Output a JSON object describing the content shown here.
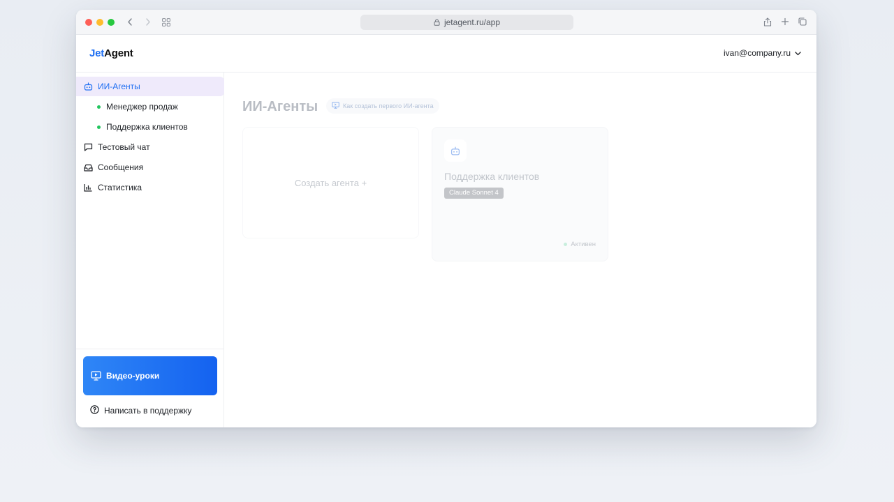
{
  "browser": {
    "url": "jetagent.ru/app"
  },
  "header": {
    "logo_part1": "Jet",
    "logo_part2": "Agent",
    "user_email": "ivan@company.ru"
  },
  "sidebar": {
    "items": [
      {
        "label": "ИИ-Агенты",
        "icon": "robot-icon",
        "active": true
      },
      {
        "label": "Тестовый чат",
        "icon": "chat-icon"
      },
      {
        "label": "Сообщения",
        "icon": "inbox-icon"
      },
      {
        "label": "Статистика",
        "icon": "bar-chart-icon"
      }
    ],
    "agents": [
      {
        "label": "Менеджер продаж",
        "status_color": "#22c55e"
      },
      {
        "label": "Поддержка клиентов",
        "status_color": "#22c55e"
      }
    ],
    "video_label": "Видео-уроки",
    "support_label": "Написать в поддержку"
  },
  "main": {
    "title": "ИИ-Агенты",
    "help_label": "Как создать первого ИИ-агента",
    "create_label": "Создать агента +",
    "agent_card": {
      "name": "Поддержка клиентов",
      "model": "Claude Sonnet 4",
      "status": "Активен"
    }
  },
  "colors": {
    "accent": "#1f6ff2",
    "active_bg": "#efeafb",
    "status_green": "#22c55e"
  }
}
